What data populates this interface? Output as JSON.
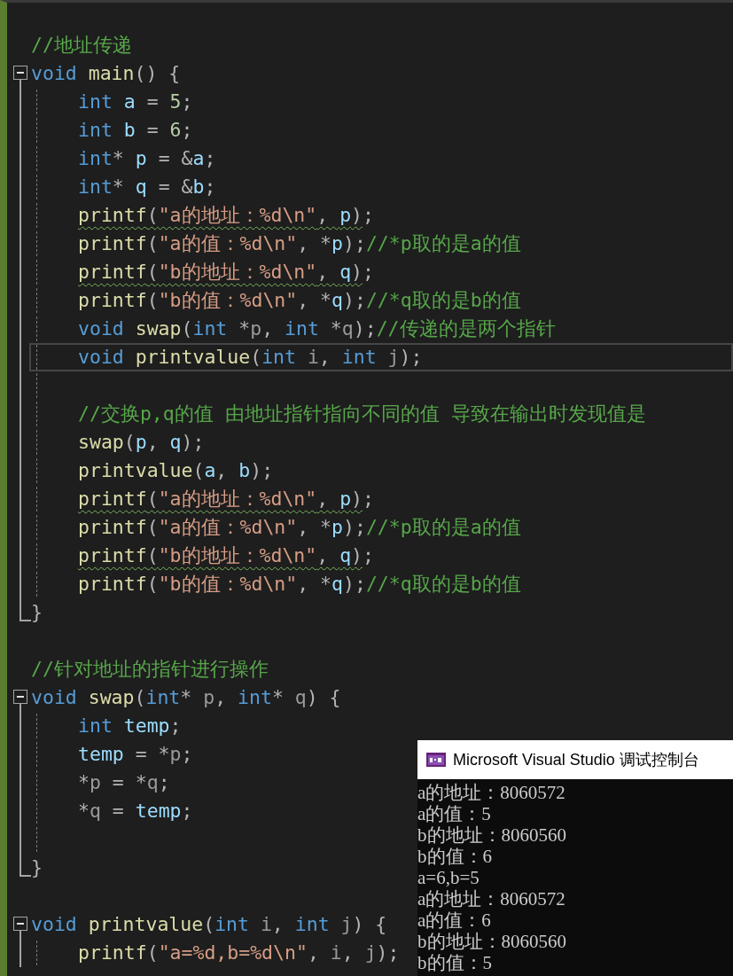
{
  "editor": {
    "lines": [
      {
        "kind": "blank"
      },
      {
        "kind": "code",
        "tokens": [
          {
            "kind": "cmt",
            "text": "//地址传递"
          }
        ],
        "squiggle": false
      },
      {
        "kind": "code",
        "tokens": [
          {
            "kind": "kw",
            "text": "void"
          },
          {
            "kind": "fn",
            "text": " main"
          },
          {
            "kind": "op",
            "text": "() {"
          }
        ],
        "squiggle": false,
        "expanded": true,
        "children": [
          {
            "kind": "code",
            "tokens": [
              {
                "kind": "kw",
                "text": "int"
              },
              {
                "kind": "var",
                "text": " a"
              },
              {
                "kind": "op",
                "text": " = "
              },
              {
                "kind": "num",
                "text": "5"
              },
              {
                "kind": "op",
                "text": ";"
              }
            ],
            "squiggle": false
          },
          {
            "kind": "code",
            "tokens": [
              {
                "kind": "kw",
                "text": "int"
              },
              {
                "kind": "var",
                "text": " b"
              },
              {
                "kind": "op",
                "text": " = "
              },
              {
                "kind": "num",
                "text": "6"
              },
              {
                "kind": "op",
                "text": ";"
              }
            ],
            "squiggle": false
          },
          {
            "kind": "code",
            "tokens": [
              {
                "kind": "kw",
                "text": "int"
              },
              {
                "kind": "op",
                "text": "* "
              },
              {
                "kind": "var",
                "text": "p"
              },
              {
                "kind": "op",
                "text": " = &"
              },
              {
                "kind": "var",
                "text": "a"
              },
              {
                "kind": "op",
                "text": ";"
              }
            ],
            "squiggle": false
          },
          {
            "kind": "code",
            "tokens": [
              {
                "kind": "kw",
                "text": "int"
              },
              {
                "kind": "op",
                "text": "* "
              },
              {
                "kind": "var",
                "text": "q"
              },
              {
                "kind": "op",
                "text": " = &"
              },
              {
                "kind": "var",
                "text": "b"
              },
              {
                "kind": "op",
                "text": ";"
              }
            ],
            "squiggle": false
          },
          {
            "kind": "code",
            "tokens": [
              {
                "kind": "fn",
                "text": "printf"
              },
              {
                "kind": "op",
                "text": "("
              },
              {
                "kind": "str",
                "text": "\"a的地址：%d\\n\""
              },
              {
                "kind": "op",
                "text": ", "
              },
              {
                "kind": "var",
                "text": "p"
              },
              {
                "kind": "op",
                "text": ")"
              },
              {
                "kind": "op",
                "text": ";"
              }
            ],
            "squiggle": true
          },
          {
            "kind": "code",
            "tokens": [
              {
                "kind": "fn",
                "text": "printf"
              },
              {
                "kind": "op",
                "text": "("
              },
              {
                "kind": "str",
                "text": "\"a的值：%d\\n\""
              },
              {
                "kind": "op",
                "text": ", *"
              },
              {
                "kind": "var",
                "text": "p"
              },
              {
                "kind": "op",
                "text": ");"
              },
              {
                "kind": "cmt",
                "text": "//*p取的是a的值"
              }
            ],
            "squiggle": false
          },
          {
            "kind": "code",
            "tokens": [
              {
                "kind": "fn",
                "text": "printf"
              },
              {
                "kind": "op",
                "text": "("
              },
              {
                "kind": "str",
                "text": "\"b的地址：%d\\n\""
              },
              {
                "kind": "op",
                "text": ", "
              },
              {
                "kind": "var",
                "text": "q"
              },
              {
                "kind": "op",
                "text": ")"
              },
              {
                "kind": "op",
                "text": ";"
              }
            ],
            "squiggle": true
          },
          {
            "kind": "code",
            "tokens": [
              {
                "kind": "fn",
                "text": "printf"
              },
              {
                "kind": "op",
                "text": "("
              },
              {
                "kind": "str",
                "text": "\"b的值：%d\\n\""
              },
              {
                "kind": "op",
                "text": ", *"
              },
              {
                "kind": "var",
                "text": "q"
              },
              {
                "kind": "op",
                "text": ");"
              },
              {
                "kind": "cmt",
                "text": "//*q取的是b的值"
              }
            ],
            "squiggle": false
          },
          {
            "kind": "code",
            "tokens": [
              {
                "kind": "kw",
                "text": "void"
              },
              {
                "kind": "fn",
                "text": " swap"
              },
              {
                "kind": "op",
                "text": "("
              },
              {
                "kind": "kw",
                "text": "int"
              },
              {
                "kind": "op",
                "text": " *"
              },
              {
                "kind": "param",
                "text": "p"
              },
              {
                "kind": "op",
                "text": ", "
              },
              {
                "kind": "kw",
                "text": "int"
              },
              {
                "kind": "op",
                "text": " *"
              },
              {
                "kind": "param",
                "text": "q"
              },
              {
                "kind": "op",
                "text": ");"
              },
              {
                "kind": "cmt",
                "text": "//传递的是两个指针"
              }
            ],
            "squiggle": false
          },
          {
            "kind": "code",
            "tokens": [
              {
                "kind": "kw",
                "text": "void"
              },
              {
                "kind": "fn",
                "text": " printvalue"
              },
              {
                "kind": "op",
                "text": "("
              },
              {
                "kind": "kw",
                "text": "int"
              },
              {
                "kind": "param",
                "text": " i"
              },
              {
                "kind": "op",
                "text": ", "
              },
              {
                "kind": "kw",
                "text": "int"
              },
              {
                "kind": "param",
                "text": " j"
              },
              {
                "kind": "op",
                "text": ");"
              }
            ],
            "squiggle": false,
            "current": true
          },
          {
            "kind": "blank"
          },
          {
            "kind": "code",
            "tokens": [
              {
                "kind": "cmt",
                "text": "//交换p,q的值 由地址指针指向不同的值 导致在输出时发现值是"
              }
            ],
            "squiggle": false
          },
          {
            "kind": "code",
            "tokens": [
              {
                "kind": "fn",
                "text": "swap"
              },
              {
                "kind": "op",
                "text": "("
              },
              {
                "kind": "var",
                "text": "p"
              },
              {
                "kind": "op",
                "text": ", "
              },
              {
                "kind": "var",
                "text": "q"
              },
              {
                "kind": "op",
                "text": ");"
              }
            ],
            "squiggle": false
          },
          {
            "kind": "code",
            "tokens": [
              {
                "kind": "fn",
                "text": "printvalue"
              },
              {
                "kind": "op",
                "text": "("
              },
              {
                "kind": "var",
                "text": "a"
              },
              {
                "kind": "op",
                "text": ", "
              },
              {
                "kind": "var",
                "text": "b"
              },
              {
                "kind": "op",
                "text": ");"
              }
            ],
            "squiggle": false
          },
          {
            "kind": "code",
            "tokens": [
              {
                "kind": "fn",
                "text": "printf"
              },
              {
                "kind": "op",
                "text": "("
              },
              {
                "kind": "str",
                "text": "\"a的地址：%d\\n\""
              },
              {
                "kind": "op",
                "text": ", "
              },
              {
                "kind": "var",
                "text": "p"
              },
              {
                "kind": "op",
                "text": ")"
              },
              {
                "kind": "op",
                "text": ";"
              }
            ],
            "squiggle": true
          },
          {
            "kind": "code",
            "tokens": [
              {
                "kind": "fn",
                "text": "printf"
              },
              {
                "kind": "op",
                "text": "("
              },
              {
                "kind": "str",
                "text": "\"a的值：%d\\n\""
              },
              {
                "kind": "op",
                "text": ", *"
              },
              {
                "kind": "var",
                "text": "p"
              },
              {
                "kind": "op",
                "text": ");"
              },
              {
                "kind": "cmt",
                "text": "//*p取的是a的值"
              }
            ],
            "squiggle": false
          },
          {
            "kind": "code",
            "tokens": [
              {
                "kind": "fn",
                "text": "printf"
              },
              {
                "kind": "op",
                "text": "("
              },
              {
                "kind": "str",
                "text": "\"b的地址：%d\\n\""
              },
              {
                "kind": "op",
                "text": ", "
              },
              {
                "kind": "var",
                "text": "q"
              },
              {
                "kind": "op",
                "text": ")"
              },
              {
                "kind": "op",
                "text": ";"
              }
            ],
            "squiggle": true
          },
          {
            "kind": "code",
            "tokens": [
              {
                "kind": "fn",
                "text": "printf"
              },
              {
                "kind": "op",
                "text": "("
              },
              {
                "kind": "str",
                "text": "\"b的值：%d\\n\""
              },
              {
                "kind": "op",
                "text": ", *"
              },
              {
                "kind": "var",
                "text": "q"
              },
              {
                "kind": "op",
                "text": ");"
              },
              {
                "kind": "cmt",
                "text": "//*q取的是b的值"
              }
            ],
            "squiggle": false
          }
        ],
        "end": {
          "kind": "code",
          "tokens": [
            {
              "kind": "op",
              "text": "}"
            }
          ],
          "squiggle": false
        }
      },
      {
        "kind": "blank"
      },
      {
        "kind": "code",
        "tokens": [
          {
            "kind": "cmt",
            "text": "//针对地址的指针进行操作"
          }
        ],
        "squiggle": false
      },
      {
        "kind": "code",
        "tokens": [
          {
            "kind": "kw",
            "text": "void"
          },
          {
            "kind": "fn",
            "text": " swap"
          },
          {
            "kind": "op",
            "text": "("
          },
          {
            "kind": "kw",
            "text": "int"
          },
          {
            "kind": "op",
            "text": "* "
          },
          {
            "kind": "param",
            "text": "p"
          },
          {
            "kind": "op",
            "text": ", "
          },
          {
            "kind": "kw",
            "text": "int"
          },
          {
            "kind": "op",
            "text": "* "
          },
          {
            "kind": "param",
            "text": "q"
          },
          {
            "kind": "op",
            "text": ") {"
          }
        ],
        "squiggle": false,
        "expanded": true,
        "children": [
          {
            "kind": "code",
            "tokens": [
              {
                "kind": "kw",
                "text": "int"
              },
              {
                "kind": "var",
                "text": " temp"
              },
              {
                "kind": "op",
                "text": ";"
              }
            ],
            "squiggle": false
          },
          {
            "kind": "code",
            "tokens": [
              {
                "kind": "var",
                "text": "temp"
              },
              {
                "kind": "op",
                "text": " = *"
              },
              {
                "kind": "param",
                "text": "p"
              },
              {
                "kind": "op",
                "text": ";"
              }
            ],
            "squiggle": false
          },
          {
            "kind": "code",
            "tokens": [
              {
                "kind": "op",
                "text": "*"
              },
              {
                "kind": "param",
                "text": "p"
              },
              {
                "kind": "op",
                "text": " = *"
              },
              {
                "kind": "param",
                "text": "q"
              },
              {
                "kind": "op",
                "text": ";"
              }
            ],
            "squiggle": false
          },
          {
            "kind": "code",
            "tokens": [
              {
                "kind": "op",
                "text": "*"
              },
              {
                "kind": "param",
                "text": "q"
              },
              {
                "kind": "op",
                "text": " = "
              },
              {
                "kind": "var",
                "text": "temp"
              },
              {
                "kind": "op",
                "text": ";"
              }
            ],
            "squiggle": false
          },
          {
            "kind": "blank"
          }
        ],
        "end": {
          "kind": "code",
          "tokens": [
            {
              "kind": "op",
              "text": "}"
            }
          ],
          "squiggle": false
        }
      },
      {
        "kind": "blank"
      },
      {
        "kind": "code",
        "tokens": [
          {
            "kind": "kw",
            "text": "void"
          },
          {
            "kind": "fn",
            "text": " printvalue"
          },
          {
            "kind": "op",
            "text": "("
          },
          {
            "kind": "kw",
            "text": "int"
          },
          {
            "kind": "param",
            "text": " i"
          },
          {
            "kind": "op",
            "text": ", "
          },
          {
            "kind": "kw",
            "text": "int"
          },
          {
            "kind": "param",
            "text": " j"
          },
          {
            "kind": "op",
            "text": ") {"
          }
        ],
        "squiggle": false,
        "expanded": true,
        "children": [
          {
            "kind": "code",
            "tokens": [
              {
                "kind": "fn",
                "text": "printf"
              },
              {
                "kind": "op",
                "text": "("
              },
              {
                "kind": "str",
                "text": "\"a=%d,b=%d\\n\""
              },
              {
                "kind": "op",
                "text": ", "
              },
              {
                "kind": "param",
                "text": "i"
              },
              {
                "kind": "op",
                "text": ", "
              },
              {
                "kind": "param",
                "text": "j"
              },
              {
                "kind": "op",
                "text": ");"
              }
            ],
            "squiggle": false
          }
        ]
      }
    ]
  },
  "console": {
    "title": "Microsoft Visual Studio 调试控制台",
    "output": [
      "a的地址：8060572",
      "a的值：5",
      "b的地址：8060560",
      "b的值：6",
      "a=6,b=5",
      "a的地址：8060572",
      "a的值：6",
      "b的地址：8060560",
      "b的值：5"
    ]
  }
}
